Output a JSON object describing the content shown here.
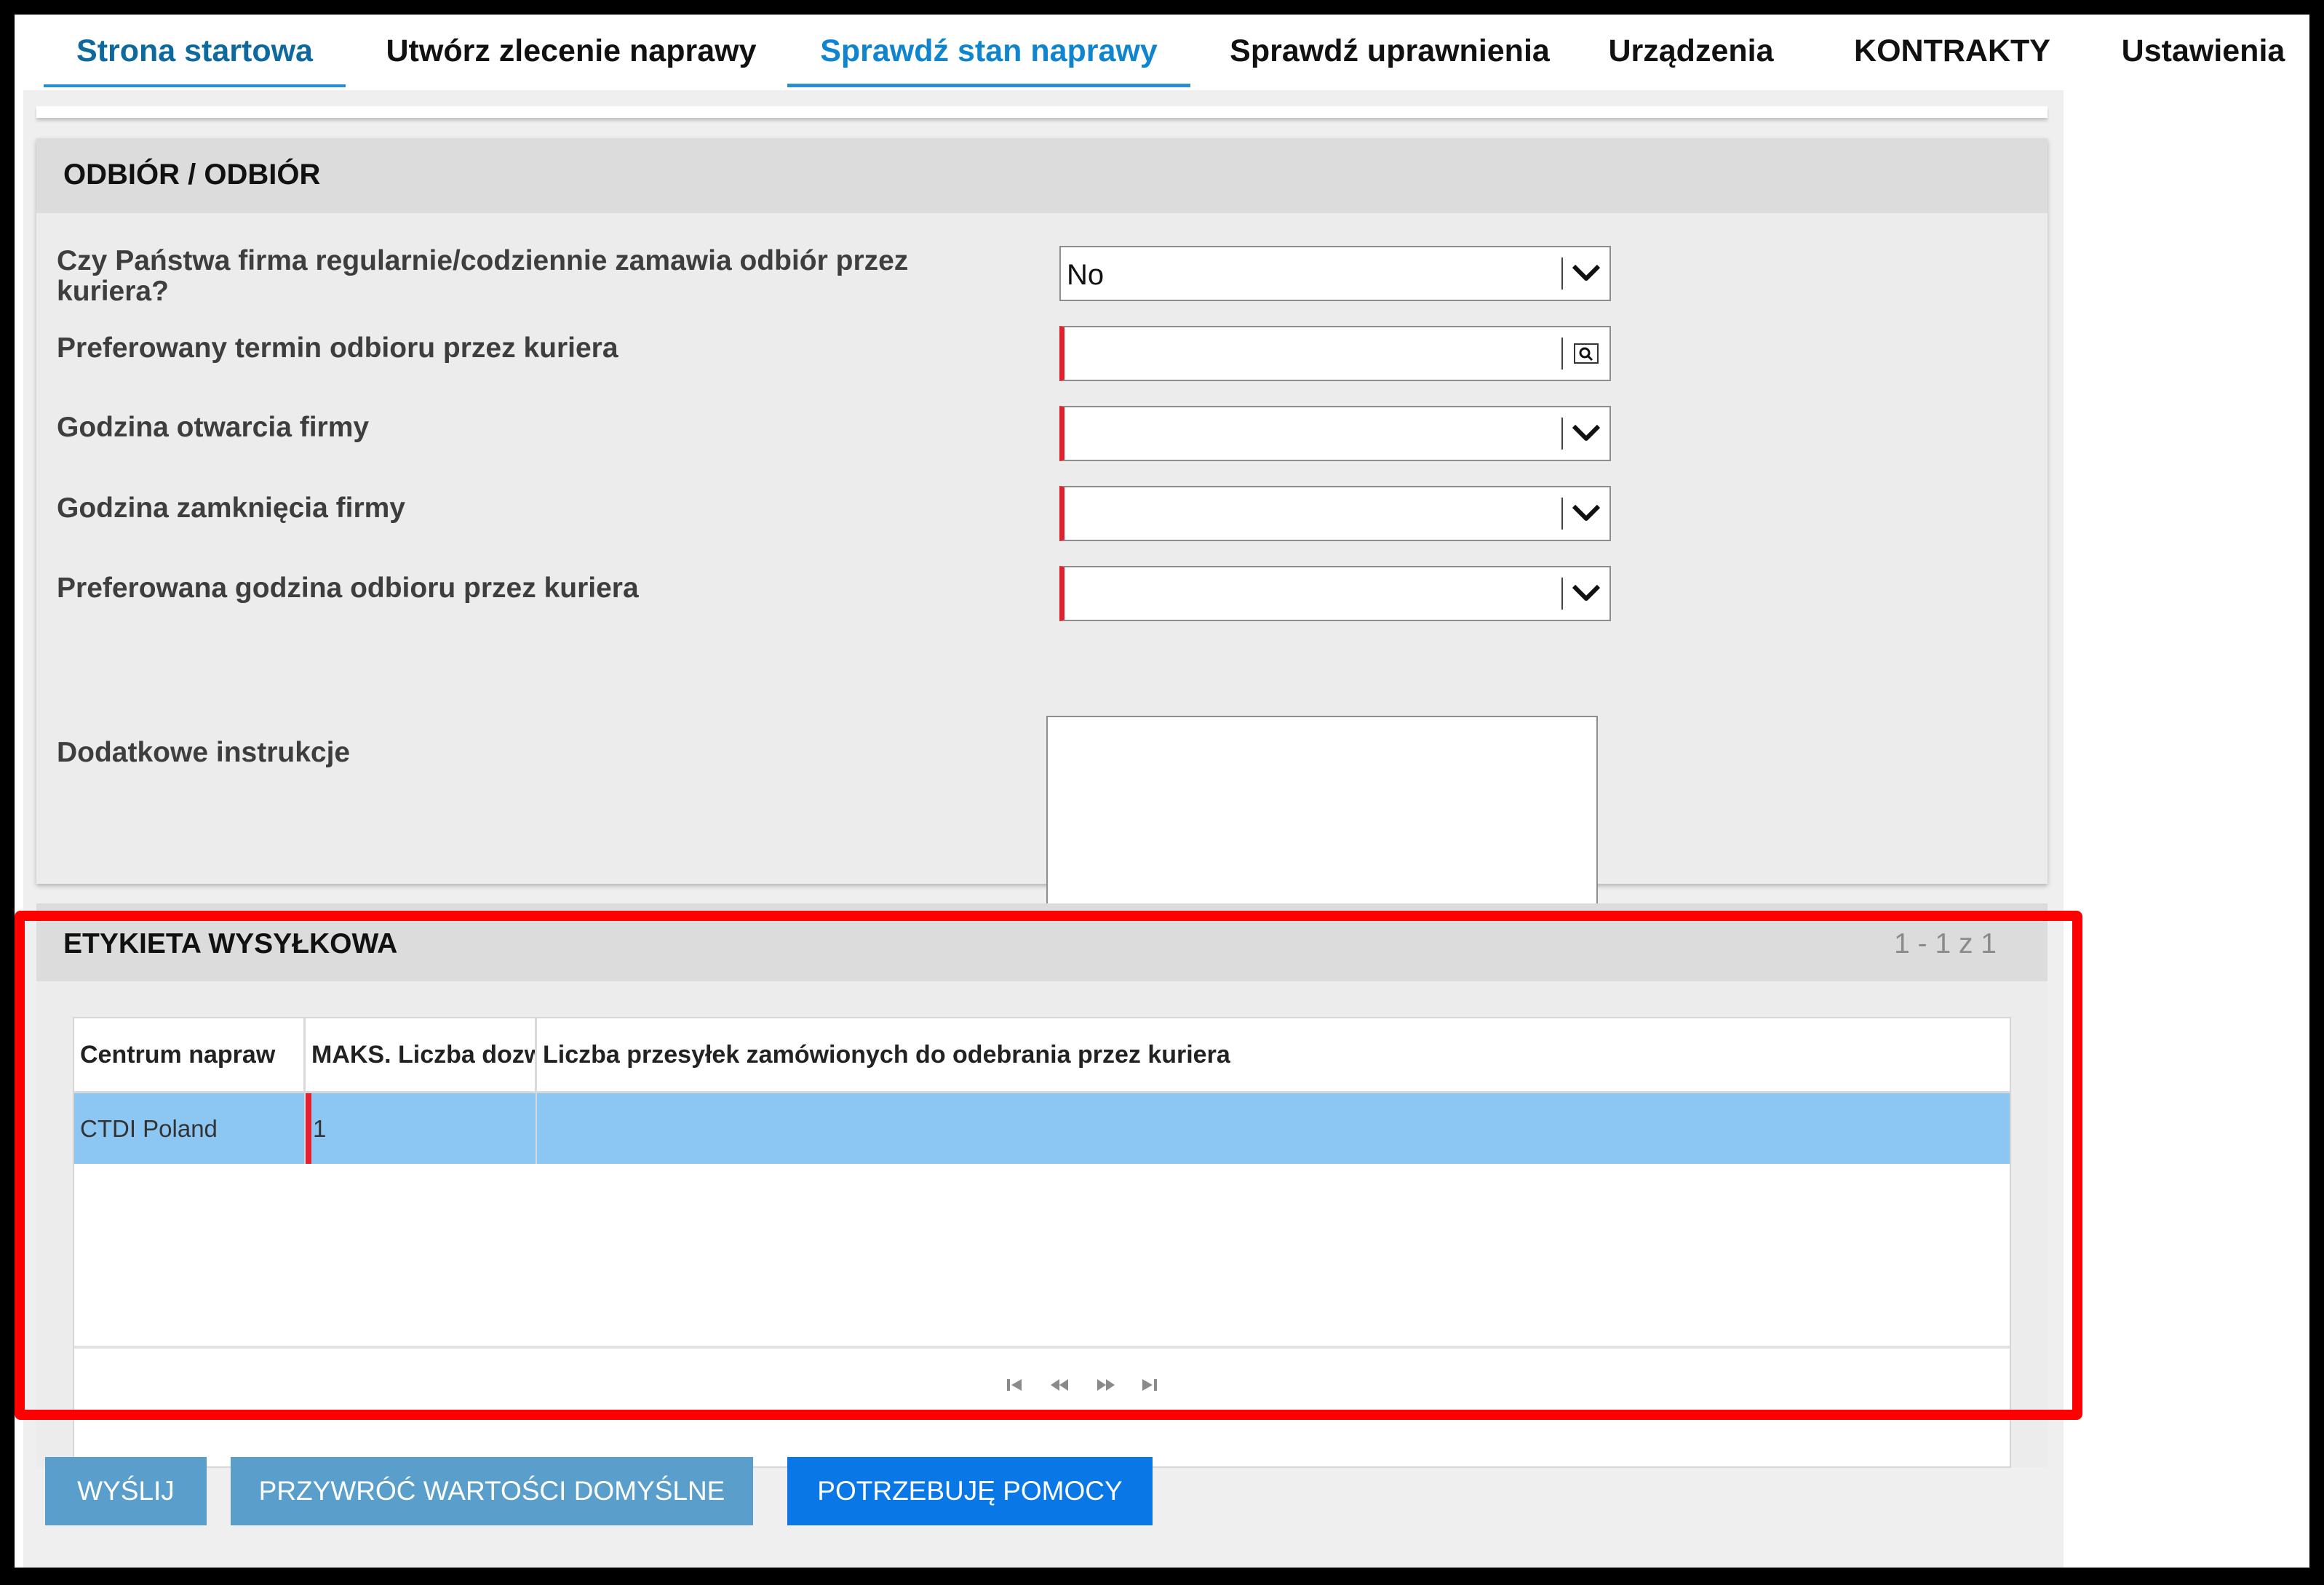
{
  "nav": {
    "tabs": [
      {
        "label": "Strona startowa"
      },
      {
        "label": "Utwórz zlecenie naprawy"
      },
      {
        "label": "Sprawdź stan naprawy"
      },
      {
        "label": "Sprawdź uprawnienia"
      },
      {
        "label": "Urządzenia"
      },
      {
        "label": "KONTRAKTY"
      },
      {
        "label": "Ustawienia"
      }
    ],
    "active_tab": "Sprawdź stan naprawy"
  },
  "pickup": {
    "title": "ODBIÓR / ODBIÓR",
    "fields": [
      {
        "label": "Czy Państwa firma regularnie/codziennie zamawia odbiór przez kuriera?",
        "type": "select",
        "value": "No",
        "required": false,
        "icon": "chevron-down-icon"
      },
      {
        "label": "Preferowany termin odbioru przez kuriera",
        "type": "lookup",
        "value": "",
        "required": true,
        "icon": "magnifier-icon"
      },
      {
        "label": "Godzina otwarcia firmy",
        "type": "select",
        "value": "",
        "required": true,
        "icon": "chevron-down-icon"
      },
      {
        "label": "Godzina zamknięcia firmy",
        "type": "select",
        "value": "",
        "required": true,
        "icon": "chevron-down-icon"
      },
      {
        "label": "Preferowana godzina odbioru przez kuriera",
        "type": "select",
        "value": "",
        "required": true,
        "icon": "chevron-down-icon"
      },
      {
        "label": "Dodatkowe instrukcje",
        "type": "textarea",
        "value": "",
        "required": false
      }
    ]
  },
  "shipping": {
    "title": "ETYKIETA WYSYŁKOWA",
    "count": "1 - 1 z 1",
    "columns": [
      "Centrum napraw",
      "MAKS. Liczba dozw",
      "Liczba przesyłek zamówionych do odebrania przez kuriera"
    ],
    "rows": [
      [
        "CTDI Poland",
        "1",
        ""
      ]
    ],
    "selected_row_color": "#8cc6f2"
  },
  "actions": {
    "submit": "WYŚLIJ",
    "reset": "PRZYWRÓĆ WARTOŚCI DOMYŚLNE",
    "help": "POTRZEBUJĘ POMOCY"
  },
  "colors": {
    "accent": "#0f85cf",
    "required": "#e3202d",
    "highlight": "#ff0000",
    "primary_button": "#0a77e6",
    "muted_button": "#5a9fcb"
  }
}
